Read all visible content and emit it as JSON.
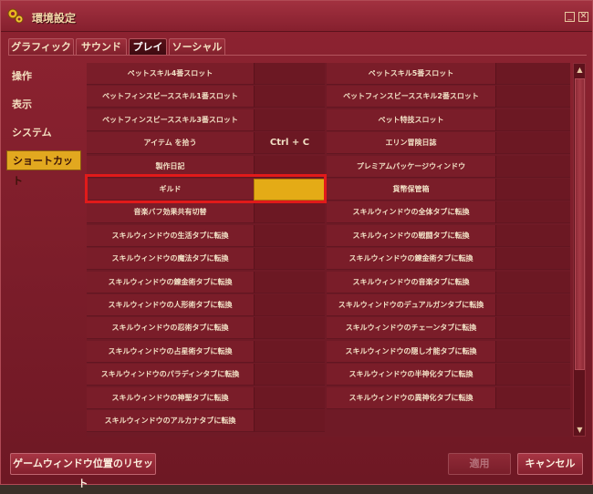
{
  "window": {
    "title": "環境設定"
  },
  "tabs": [
    {
      "label": "グラフィック"
    },
    {
      "label": "サウンド"
    },
    {
      "label": "プレイ"
    },
    {
      "label": "ソーシャル"
    }
  ],
  "sidebar": {
    "items": [
      {
        "label": "操作"
      },
      {
        "label": "表示"
      },
      {
        "label": "システム"
      },
      {
        "label": "ショートカット"
      }
    ]
  },
  "shortcuts": {
    "left": [
      {
        "action": "ペットスキル4番スロット",
        "key": ""
      },
      {
        "action": "ペットフィンスビーススキル1番スロット",
        "key": ""
      },
      {
        "action": "ペットフィンスビーススキル3番スロット",
        "key": ""
      },
      {
        "action": "アイテム を拾う",
        "key": "Ctrl + C"
      },
      {
        "action": "製作日記",
        "key": ""
      },
      {
        "action": "ギルド",
        "key": ""
      },
      {
        "action": "音楽バフ効果共有切替",
        "key": ""
      },
      {
        "action": "スキルウィンドウの生活タブに転換",
        "key": ""
      },
      {
        "action": "スキルウィンドウの魔法タブに転換",
        "key": ""
      },
      {
        "action": "スキルウィンドウの錬金術タブに転換",
        "key": ""
      },
      {
        "action": "スキルウィンドウの人形術タブに転換",
        "key": ""
      },
      {
        "action": "スキルウィンドウの忍術タブに転換",
        "key": ""
      },
      {
        "action": "スキルウィンドウの占星術タブに転換",
        "key": ""
      },
      {
        "action": "スキルウィンドウのパラディンタブに転換",
        "key": ""
      },
      {
        "action": "スキルウィンドウの神聖タブに転換",
        "key": ""
      },
      {
        "action": "スキルウィンドウのアルカナタブに転換",
        "key": ""
      }
    ],
    "right": [
      {
        "action": "ペットスキル5番スロット",
        "key": ""
      },
      {
        "action": "ペットフィンスビーススキル2番スロット",
        "key": ""
      },
      {
        "action": "ペット特技スロット",
        "key": ""
      },
      {
        "action": "エリン冒険日誌",
        "key": ""
      },
      {
        "action": "プレミアムパッケージウィンドウ",
        "key": ""
      },
      {
        "action": "貨幣保管箱",
        "key": ""
      },
      {
        "action": "スキルウィンドウの全体タブに転換",
        "key": ""
      },
      {
        "action": "スキルウィンドウの戦闘タブに転換",
        "key": ""
      },
      {
        "action": "スキルウィンドウの錬金術タブに転換",
        "key": ""
      },
      {
        "action": "スキルウィンドウの音楽タブに転換",
        "key": ""
      },
      {
        "action": "スキルウィンドウのデュアルガンタブに転換",
        "key": ""
      },
      {
        "action": "スキルウィンドウのチェーンタブに転換",
        "key": ""
      },
      {
        "action": "スキルウィンドウの隠し才能タブに転換",
        "key": ""
      },
      {
        "action": "スキルウィンドウの半神化タブに転換",
        "key": ""
      },
      {
        "action": "スキルウィンドウの異神化タブに転換",
        "key": ""
      }
    ]
  },
  "footer": {
    "reset_label": "ゲームウィンドウ位置のリセット",
    "apply_label": "適用",
    "cancel_label": "キャンセル"
  },
  "colors": {
    "accent": "#e2a81f",
    "highlight": "#e11a1a",
    "background": "#7c1d2a"
  },
  "icons": {
    "title": "gear-icon",
    "minimize": "minimize-icon",
    "close": "close-icon"
  }
}
